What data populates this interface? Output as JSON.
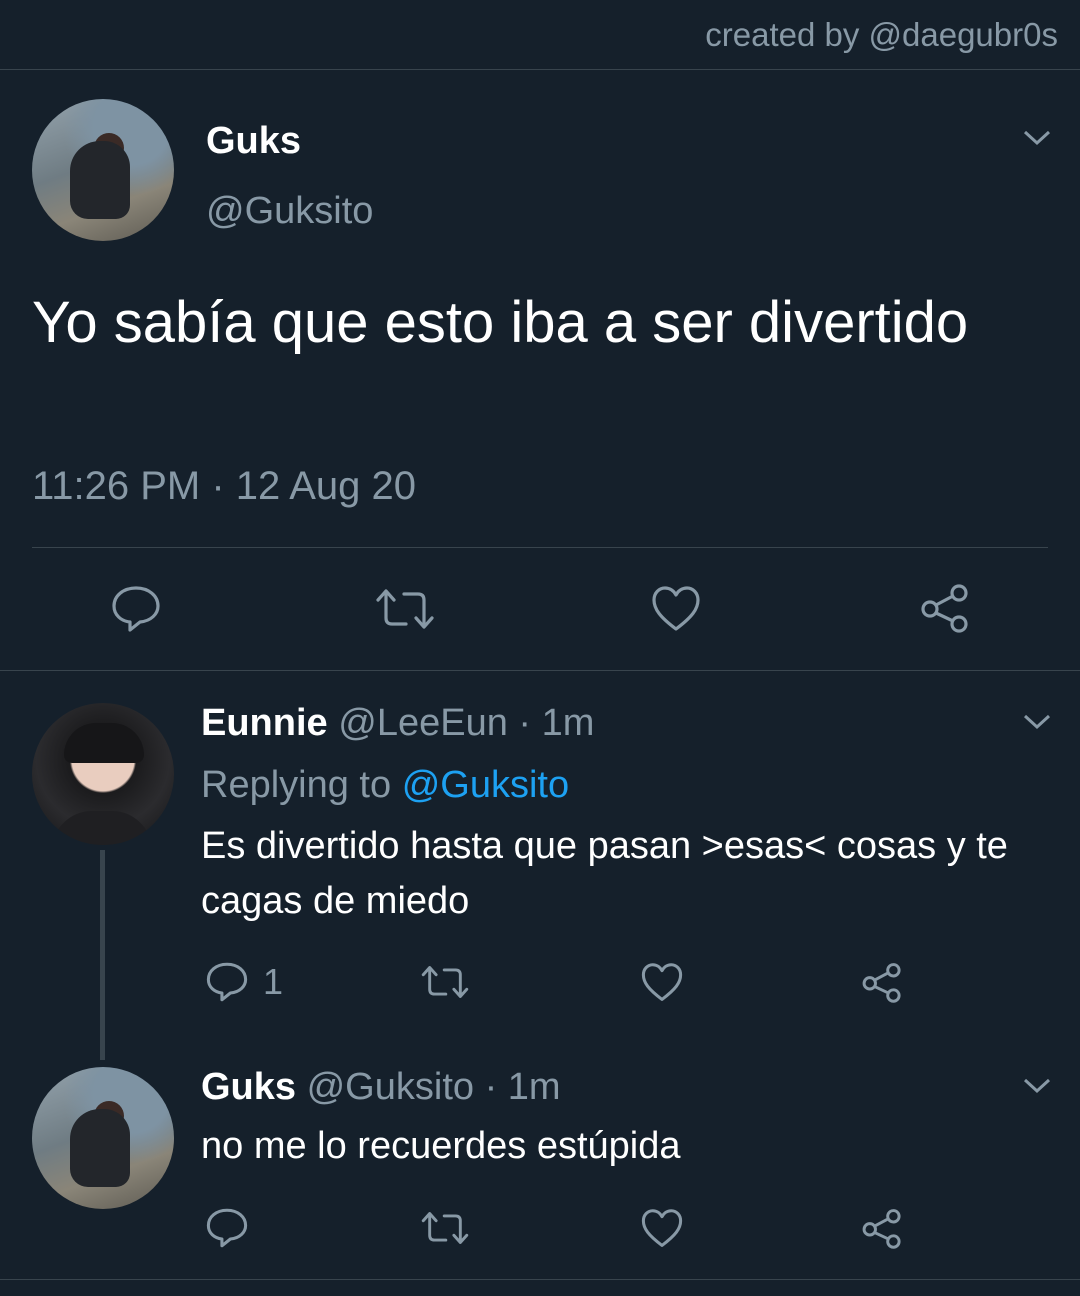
{
  "credit": "created by @daegubr0s",
  "main_tweet": {
    "name": "Guks",
    "handle": "@Guksito",
    "text": "Yo sabía que esto iba a ser divertido",
    "timestamp": "11:26 PM · 12 Aug 20",
    "actions": [
      "reply-icon",
      "retweet-icon",
      "like-icon",
      "share-icon"
    ]
  },
  "replies": [
    {
      "name": "Eunnie",
      "handle": "@LeeEun",
      "time": "· 1m",
      "replying_label": "Replying to",
      "replying_to": "@Guksito",
      "text": "Es divertido hasta que pasan >esas< cosas y te cagas de miedo",
      "reply_count": "1"
    },
    {
      "name": "Guks",
      "handle": "@Guksito",
      "time": "· 1m",
      "text": "no me lo recuerdes estúpida"
    }
  ],
  "colors": {
    "background": "#15202b",
    "muted": "#8899a6",
    "accent": "#1da1f2",
    "divider": "#38444d"
  }
}
